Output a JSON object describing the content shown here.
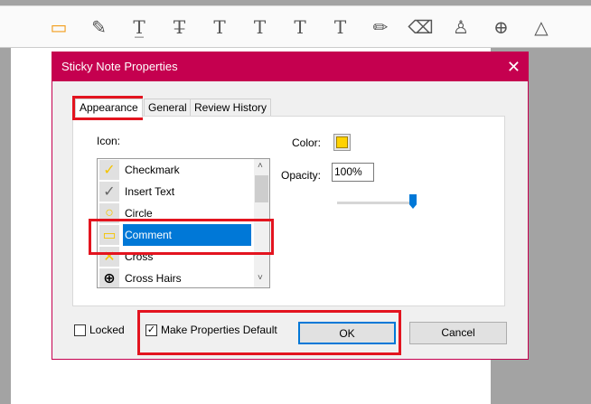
{
  "toolbar": {
    "tools": [
      {
        "name": "sticky-note-icon",
        "glyph": "▭"
      },
      {
        "name": "highlight-icon",
        "glyph": "✎"
      },
      {
        "name": "underline-text-icon",
        "glyph": "T̲"
      },
      {
        "name": "strikethrough-text-icon",
        "glyph": "T̶"
      },
      {
        "name": "replace-text-icon",
        "glyph": "T"
      },
      {
        "name": "insert-text-icon",
        "glyph": "T"
      },
      {
        "name": "add-text-icon",
        "glyph": "T"
      },
      {
        "name": "text-box-icon",
        "glyph": "T"
      },
      {
        "name": "pencil-icon",
        "glyph": "✏"
      },
      {
        "name": "eraser-icon",
        "glyph": "⌫"
      },
      {
        "name": "stamp-icon",
        "glyph": "♙"
      },
      {
        "name": "attach-file-icon",
        "glyph": "⊕"
      },
      {
        "name": "shapes-icon",
        "glyph": "△"
      }
    ]
  },
  "dialog": {
    "title": "Sticky Note Properties",
    "close": "✕",
    "tabs": [
      "Appearance",
      "General",
      "Review History"
    ],
    "icon_label": "Icon:",
    "icons": [
      {
        "label": "Checkmark",
        "glyph": "✓",
        "color": "#f5c400"
      },
      {
        "label": "Insert Text",
        "glyph": "✓",
        "color": "#666666"
      },
      {
        "label": "Circle",
        "glyph": "○",
        "color": "#f5c400"
      },
      {
        "label": "Comment",
        "glyph": "▭",
        "color": "#f5c400"
      },
      {
        "label": "Cross",
        "glyph": "✕",
        "color": "#f5c400"
      },
      {
        "label": "Cross Hairs",
        "glyph": "⊕",
        "color": "#000000"
      }
    ],
    "selected_icon": "Comment",
    "color_label": "Color:",
    "color_value": "#ffd200",
    "opacity_label": "Opacity:",
    "opacity_value": "100%",
    "opacity_fraction": 1.0,
    "locked_label": "Locked",
    "locked": false,
    "default_label": "Make Properties Default",
    "default_checked": true,
    "check_glyph": "✓",
    "ok": "OK",
    "cancel": "Cancel"
  }
}
